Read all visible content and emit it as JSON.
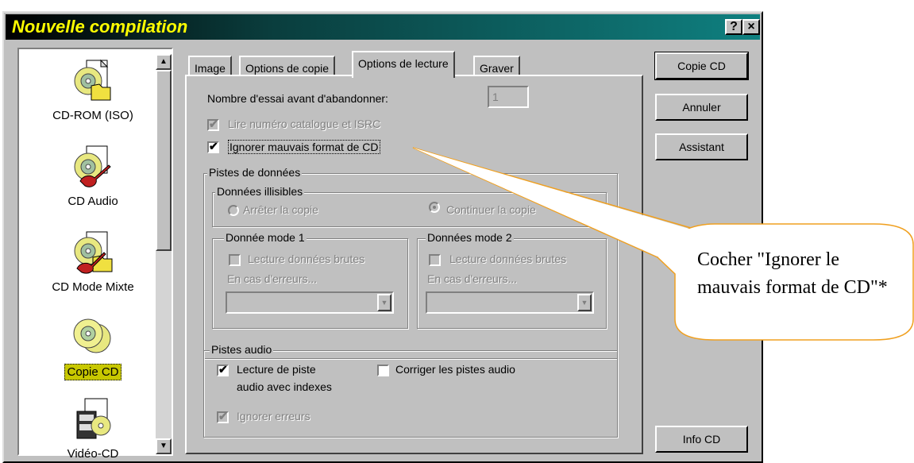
{
  "window": {
    "title": "Nouvelle compilation",
    "help_label": "?",
    "close_label": "×"
  },
  "sidebar": {
    "items": [
      {
        "label": "CD-ROM (ISO)",
        "icon": "cd-folder-icon",
        "selected": false
      },
      {
        "label": "CD Audio",
        "icon": "cd-guitar-icon",
        "selected": false
      },
      {
        "label": "CD Mode Mixte",
        "icon": "cd-mixed-icon",
        "selected": false
      },
      {
        "label": "Copie CD",
        "icon": "cd-copy-icon",
        "selected": true
      },
      {
        "label": "Vidéo-CD",
        "icon": "video-cd-icon",
        "selected": false
      }
    ]
  },
  "tabs": [
    {
      "label": "Image",
      "active": false
    },
    {
      "label": "Options de copie",
      "active": false
    },
    {
      "label": "Options de lecture",
      "active": true
    },
    {
      "label": "Graver",
      "active": false
    }
  ],
  "panel": {
    "retries_label": "Nombre d'essai avant d'abandonner:",
    "retries_value": "1",
    "read_catalog_label": "Lire numéro catalogue et ISRC",
    "ignore_bad_format_label": "Ignorer mauvais format de CD",
    "data_tracks": {
      "legend": "Pistes de données",
      "unreadable": {
        "legend": "Données illisibles",
        "stop_label": "Arrêter la copie",
        "continue_label": "Continuer la copie"
      },
      "mode1": {
        "legend": "Donnée mode 1",
        "raw_label": "Lecture données brutes",
        "on_error_label": "En cas d'erreurs..."
      },
      "mode2": {
        "legend": "Données mode 2",
        "raw_label": "Lecture données brutes",
        "on_error_label": "En cas d'erreurs..."
      }
    },
    "audio_tracks": {
      "legend": "Pistes audio",
      "index_read_label_line1": "Lecture de piste",
      "index_read_label_line2": "audio avec indexes",
      "correct_label": "Corriger les pistes audio",
      "ignore_errors_label": "Ignorer erreurs"
    }
  },
  "buttons": {
    "copy_cd": "Copie CD",
    "cancel": "Annuler",
    "wizard": "Assistant",
    "cd_info": "Info CD"
  },
  "callout": {
    "text": "Cocher \"Ignorer le mauvais format de CD\"*",
    "border_color": "#f0a020"
  }
}
